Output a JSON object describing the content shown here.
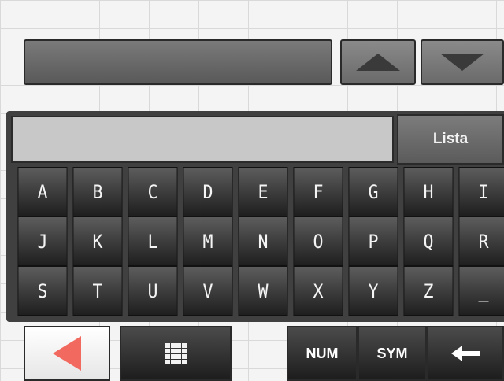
{
  "top": {
    "field_value": "",
    "up_icon": "triangle-up-icon",
    "down_icon": "triangle-down-icon"
  },
  "input": {
    "value": "",
    "list_button": "Lista"
  },
  "keyboard": {
    "rows": [
      [
        "A",
        "B",
        "C",
        "D",
        "E",
        "F",
        "G",
        "H",
        "I"
      ],
      [
        "J",
        "K",
        "L",
        "M",
        "N",
        "O",
        "P",
        "Q",
        "R"
      ],
      [
        "S",
        "T",
        "U",
        "V",
        "W",
        "X",
        "Y",
        "Z",
        "_"
      ]
    ]
  },
  "bottom": {
    "back_icon": "triangle-left-icon",
    "grid_icon": "keypad-grid-icon",
    "num_label": "NUM",
    "sym_label": "SYM",
    "backspace_icon": "arrow-left-icon"
  },
  "colors": {
    "accent_red": "#f26a5f",
    "key_dark": "#2e2e2e"
  }
}
